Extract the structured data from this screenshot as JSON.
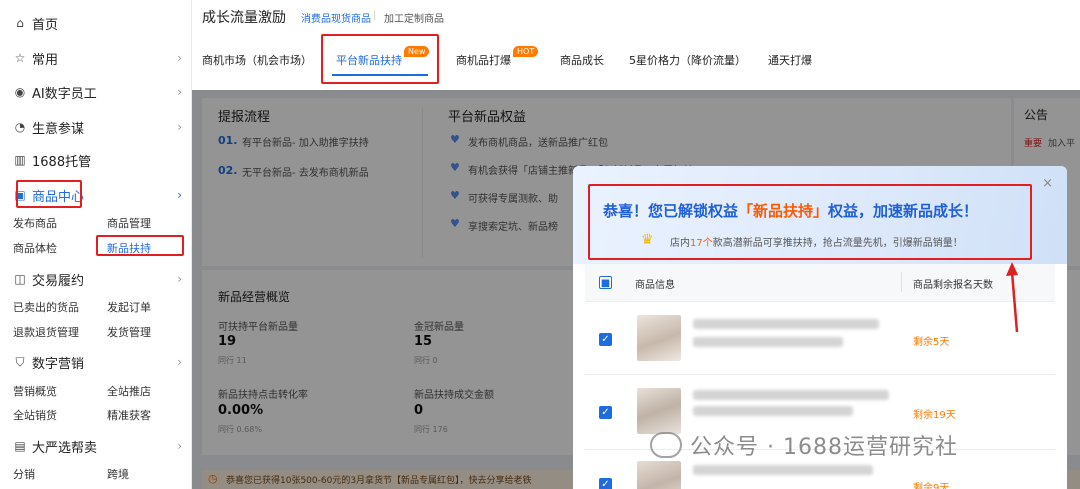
{
  "sidebar": {
    "items": [
      {
        "label": "首页"
      },
      {
        "label": "常用"
      },
      {
        "label": "AI数字员工"
      },
      {
        "label": "生意参谋"
      },
      {
        "label": "1688托管"
      },
      {
        "label": "商品中心"
      },
      {
        "label": "交易履约"
      },
      {
        "label": "数字营销"
      },
      {
        "label": "大严选帮卖"
      }
    ],
    "product_sub": [
      "发布商品",
      "商品管理",
      "商品体检",
      "新品扶持"
    ],
    "trade_sub": [
      "已卖出的货品",
      "发起订单",
      "退款退货管理",
      "发货管理"
    ],
    "marketing_sub": [
      "营销概览",
      "全站推店",
      "全站销货",
      "精准获客"
    ],
    "yanxuan_sub": [
      "分销",
      "跨境"
    ]
  },
  "header": {
    "title": "成长流量激励",
    "crumb1": "消费品现货商品",
    "crumb2": "加工定制商品",
    "tabs": [
      "商机市场（机会市场）",
      "平台新品扶持",
      "商机品打爆",
      "商品成长",
      "5星价格力（降价流量）",
      "通天打爆"
    ],
    "tag_new": "New",
    "tag_hot": "HOT"
  },
  "main": {
    "process_title": "提报流程",
    "step1_num": "01.",
    "step1_text": "有平台新品- 加入助推字扶持",
    "step2_num": "02.",
    "step2_text": "无平台新品- 去发布商机新品",
    "rights_title": "平台新品权益",
    "rights": [
      "发布商机商品，送新品推广红包",
      "有机会获得「店铺主推新品」「七新新品」专属权益",
      "可获得专属测款、助",
      "享搜索定坑、新品榜"
    ],
    "notice_title": "公告",
    "notice_tag": "重要",
    "notice_text": "加入平",
    "overview_title": "新品经营概览",
    "metrics": [
      {
        "label": "可扶持平台新品量",
        "value": "19",
        "sub": "同行 11"
      },
      {
        "label": "金冠新品量",
        "value": "15",
        "sub": "同行 0"
      },
      {
        "label": "新品扶持点击转化率",
        "value": "0.00%",
        "sub": "同行 0.68%"
      },
      {
        "label": "新品扶持成交金额",
        "value": "0",
        "sub": "同行 176"
      }
    ],
    "bottom_banner": "恭喜您已获得10张500-60元的3月拿货节【新品专属红包】，快去分享给老铁"
  },
  "modal": {
    "title_pre": "恭喜！您已解锁权益",
    "title_highlight": "「新品扶持」",
    "title_post": "权益，加速新品成长！",
    "sub_pre": "店内",
    "sub_count": "17个",
    "sub_post": "款高潜新品可享推扶持，抢占流量先机，引爆新品销量！",
    "col_info": "商品信息",
    "col_days": "商品剩余报名天数",
    "rows": [
      {
        "remain": "剩余5天"
      },
      {
        "remain": "剩余19天"
      },
      {
        "remain": "剩余9天"
      }
    ]
  },
  "watermark": "公众号 · 1688运营研究社",
  "colors": {
    "accent": "#1f6be0",
    "highlight_red": "#e02020",
    "orange": "#ff6a00"
  }
}
